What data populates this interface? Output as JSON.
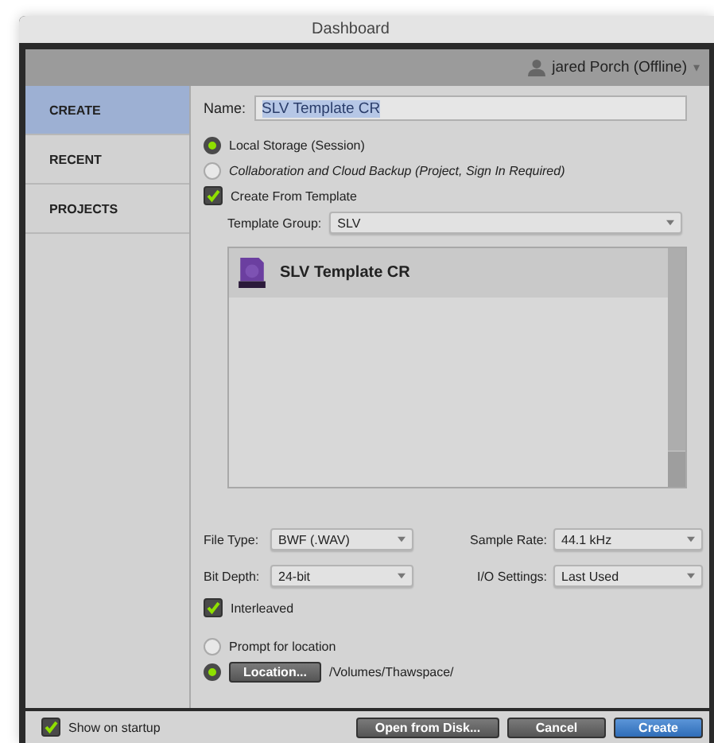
{
  "window": {
    "title": "Dashboard"
  },
  "user": {
    "name": "jared Porch (Offline)",
    "menu_glyph": "▾"
  },
  "sidebar": {
    "items": [
      {
        "label": "CREATE",
        "selected": true
      },
      {
        "label": "RECENT",
        "selected": false
      },
      {
        "label": "PROJECTS",
        "selected": false
      }
    ]
  },
  "create": {
    "name_label": "Name:",
    "name_value": "SLV Template CR",
    "storage": [
      {
        "label": "Local Storage (Session)",
        "selected": true,
        "italic": false
      },
      {
        "label": "Collaboration and Cloud Backup (Project, Sign In Required)",
        "selected": false,
        "italic": true
      }
    ],
    "from_template": {
      "label": "Create From Template",
      "checked": true
    },
    "template_group": {
      "label": "Template Group:",
      "value": "SLV"
    },
    "templates": [
      {
        "name": "SLV Template CR",
        "selected": true
      }
    ],
    "settings": [
      {
        "label": "File Type:",
        "value": "BWF (.WAV)"
      },
      {
        "label": "Sample Rate:",
        "value": "44.1 kHz"
      },
      {
        "label": "Bit Depth:",
        "value": "24-bit"
      },
      {
        "label": "I/O Settings:",
        "value": "Last Used"
      }
    ],
    "interleaved": {
      "label": "Interleaved",
      "checked": true
    },
    "location": [
      {
        "kind": "prompt",
        "label": "Prompt for location",
        "selected": false
      },
      {
        "kind": "button",
        "label": "Location...",
        "path": "/Volumes/Thawspace/",
        "selected": true
      }
    ]
  },
  "footer": {
    "show_on_startup": {
      "label": "Show on startup",
      "checked": true
    },
    "buttons": [
      {
        "label": "Open from Disk...",
        "kind": "dark"
      },
      {
        "label": "Cancel",
        "kind": "dark"
      },
      {
        "label": "Create",
        "kind": "primary"
      }
    ]
  }
}
